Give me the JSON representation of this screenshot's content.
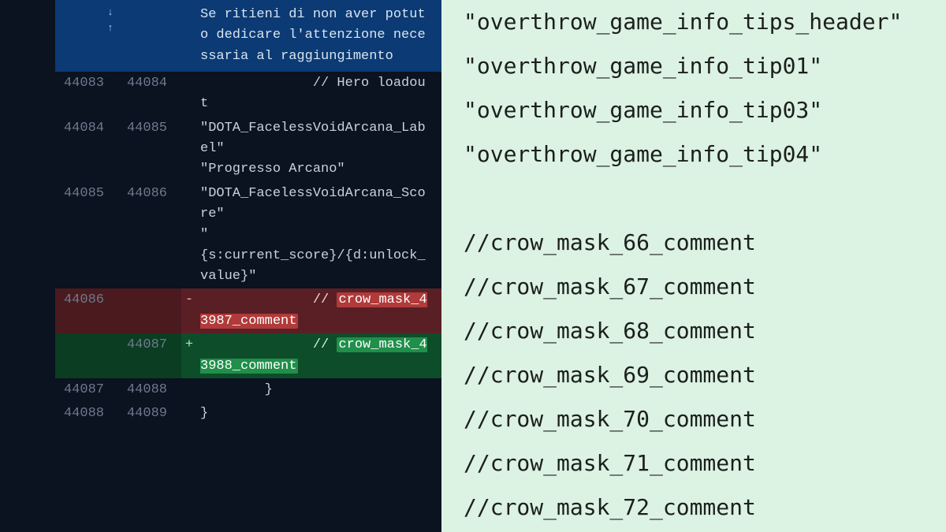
{
  "diff": {
    "expand": {
      "icon_up": "↑",
      "icon_down": "↓",
      "context_text": "Se ritieni di non aver potuto dedicare l'attenzione necessaria al raggiungimento"
    },
    "rows": [
      {
        "type": "ctx",
        "old": "44083",
        "new": "44084",
        "gutter": "",
        "text": "              // Hero loadout"
      },
      {
        "type": "ctx",
        "old": "44084",
        "new": "44085",
        "gutter": "",
        "text": "\"DOTA_FacelessVoidArcana_Label\"\n\"Progresso Arcano\""
      },
      {
        "type": "ctx",
        "old": "44085",
        "new": "44086",
        "gutter": "",
        "text": "\"DOTA_FacelessVoidArcana_Score\"\n\"\n{s:current_score}/{d:unlock_value}\""
      },
      {
        "type": "del",
        "old": "44086",
        "new": "",
        "gutter": "-",
        "prefix": "              // ",
        "token": "crow_mask_43987_comment"
      },
      {
        "type": "add",
        "old": "",
        "new": "44087",
        "gutter": "+",
        "prefix": "              // ",
        "token": "crow_mask_43988_comment"
      },
      {
        "type": "ctx",
        "old": "44087",
        "new": "44088",
        "gutter": "",
        "text": "        }"
      },
      {
        "type": "ctx",
        "old": "44088",
        "new": "44089",
        "gutter": "",
        "text": "}"
      }
    ]
  },
  "right_panel": {
    "lines_top": [
      "\"overthrow_game_info_tips_header\"",
      "\"overthrow_game_info_tip01\"",
      "\"overthrow_game_info_tip03\"",
      "\"overthrow_game_info_tip04\""
    ],
    "lines_bottom": [
      "//crow_mask_66_comment",
      "//crow_mask_67_comment",
      "//crow_mask_68_comment",
      "//crow_mask_69_comment",
      "//crow_mask_70_comment",
      "//crow_mask_71_comment",
      "//crow_mask_72_comment"
    ]
  }
}
